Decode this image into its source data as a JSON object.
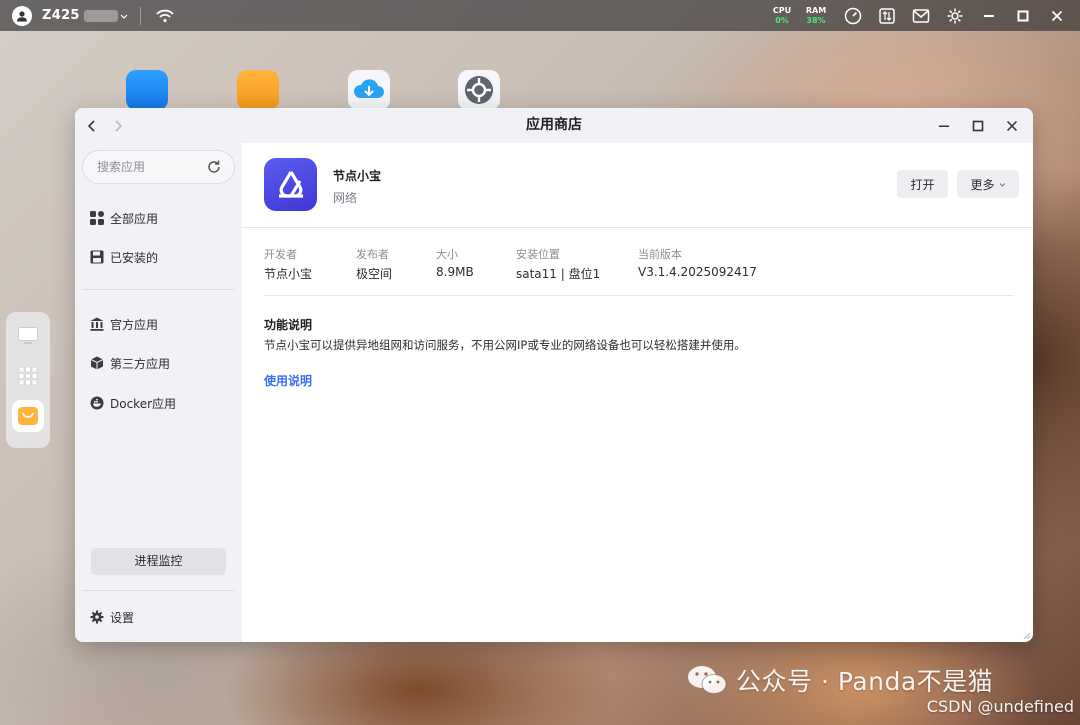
{
  "topbar": {
    "device_name": "Z425",
    "cpu_label": "CPU",
    "cpu_value": "0%",
    "ram_label": "RAM",
    "ram_value": "38%"
  },
  "window": {
    "title": "应用商店"
  },
  "search": {
    "placeholder": "搜索应用"
  },
  "sidebar": {
    "items": [
      {
        "label": "全部应用",
        "icon": "grid-icon"
      },
      {
        "label": "已安装的",
        "icon": "save-icon"
      },
      {
        "label": "官方应用",
        "icon": "bank-icon"
      },
      {
        "label": "第三方应用",
        "icon": "box-icon"
      },
      {
        "label": "Docker应用",
        "icon": "docker-icon"
      }
    ],
    "process_button": "进程监控",
    "settings_label": "设置"
  },
  "app": {
    "name": "节点小宝",
    "category": "网络",
    "open_button": "打开",
    "more_button": "更多",
    "meta": [
      {
        "key": "开发者",
        "value": "节点小宝"
      },
      {
        "key": "发布者",
        "value": "极空间"
      },
      {
        "key": "大小",
        "value": "8.9MB"
      },
      {
        "key": "安装位置",
        "value": "sata11 | 盘位1"
      },
      {
        "key": "当前版本",
        "value": "V3.1.4.2025092417"
      }
    ],
    "feature_title": "功能说明",
    "feature_desc": "节点小宝可以提供异地组网和访问服务，不用公网IP或专业的网络设备也可以轻松搭建并使用。",
    "usage_link": "使用说明"
  },
  "watermark": {
    "wechat": "公众号 · Panda不是猫",
    "csdn": "CSDN @undefined"
  },
  "colors": {
    "accent_link": "#3b6ff5",
    "app_logo": "#4a45e0",
    "meter_green": "#4ee37a"
  }
}
